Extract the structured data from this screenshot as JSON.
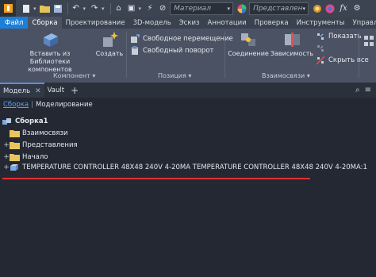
{
  "quick_access": {
    "material_placeholder": "Материал",
    "appearance_placeholder": "Представлен",
    "fx_label": "fx"
  },
  "tabs": [
    "Файл",
    "Сборка",
    "Проектирование",
    "3D-модель",
    "Эскиз",
    "Аннотации",
    "Проверка",
    "Инструменты",
    "Управле"
  ],
  "active_tab": "Сборка",
  "ribbon": {
    "component": {
      "insert_label": "Вставить из Библиотеки компонентов",
      "create_label": "Создать",
      "panel_label": "Компонент"
    },
    "position": {
      "free_move": "Свободное перемещение",
      "free_rotate": "Свободный поворот",
      "panel_label": "Позиция"
    },
    "relationships": {
      "joint": "Соединение",
      "constraint": "Зависимость",
      "show": "Показать",
      "hide_all": "Скрыть все",
      "panel_label": "Взаимосвязи"
    }
  },
  "browser": {
    "tab_model": "Модель",
    "tab_vault": "Vault",
    "filter_assembly": "Сборка",
    "filter_modeling": "Моделирование"
  },
  "tree": {
    "root": "Сборка1",
    "items": [
      "Взаимосвязи",
      "Представления",
      "Начало"
    ],
    "part": "TEMPERATURE CONTROLLER 48X48 240V 4-20MA TEMPERATURE CONTROLLER 48X48 240V 4-20MA:1"
  },
  "colors": {
    "file_tab": "#1e7fd8",
    "ribbon_bg": "#4a5263",
    "browser_bg": "#232833",
    "highlight_line": "#e23030",
    "link": "#5aa0f0"
  }
}
